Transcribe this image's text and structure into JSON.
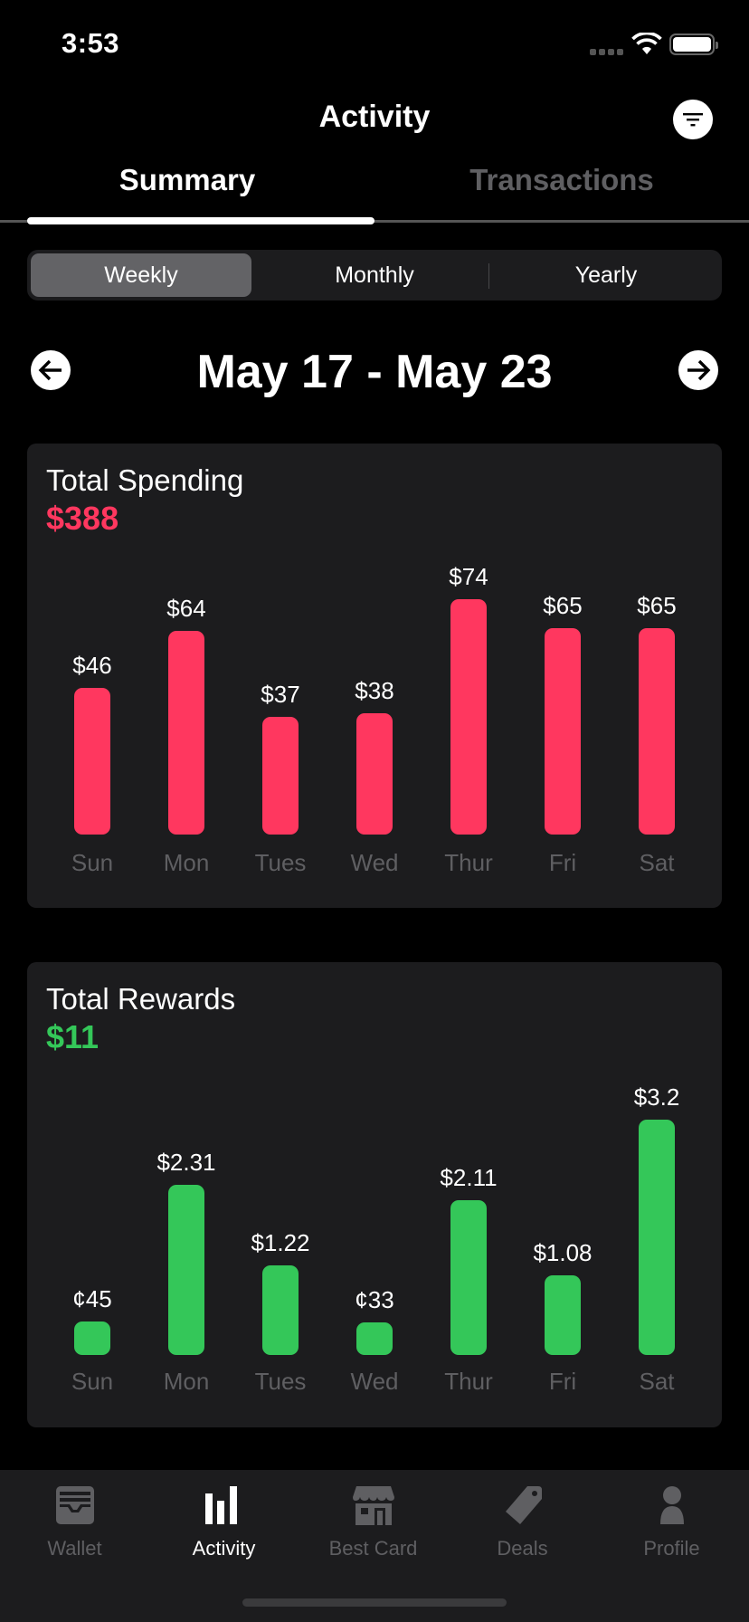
{
  "status_bar": {
    "time": "3:53"
  },
  "nav": {
    "title": "Activity",
    "filter_icon": "filter-icon"
  },
  "tabs": [
    {
      "label": "Summary",
      "active": true
    },
    {
      "label": "Transactions",
      "active": false
    }
  ],
  "period_selector": {
    "options": [
      "Weekly",
      "Monthly",
      "Yearly"
    ],
    "selected": "Weekly"
  },
  "date_range": {
    "label": "May 17 - May 23",
    "prev_icon": "arrow-left-circle-icon",
    "next_icon": "arrow-right-circle-icon"
  },
  "colors": {
    "spending": "#ff375f",
    "rewards": "#34c759",
    "card_bg": "#1c1c1e",
    "inactive": "#5f5f62"
  },
  "spending": {
    "title": "Total Spending",
    "total": "$388"
  },
  "rewards": {
    "title": "Total Rewards",
    "total": "$11"
  },
  "chart_data": [
    {
      "type": "bar",
      "title": "Total Spending",
      "categories": [
        "Sun",
        "Mon",
        "Tues",
        "Wed",
        "Thur",
        "Fri",
        "Sat"
      ],
      "values": [
        46,
        64,
        37,
        38,
        74,
        65,
        65
      ],
      "value_labels": [
        "$46",
        "$64",
        "$37",
        "$38",
        "$74",
        "$65",
        "$65"
      ],
      "xlabel": "",
      "ylabel": "",
      "ylim": [
        0,
        74
      ],
      "grid": false
    },
    {
      "type": "bar",
      "title": "Total Rewards",
      "categories": [
        "Sun",
        "Mon",
        "Tues",
        "Wed",
        "Thur",
        "Fri",
        "Sat"
      ],
      "values": [
        0.45,
        2.31,
        1.22,
        0.33,
        2.11,
        1.08,
        3.2
      ],
      "value_labels": [
        "¢45",
        "$2.31",
        "$1.22",
        "¢33",
        "$2.11",
        "$1.08",
        "$3.2"
      ],
      "xlabel": "",
      "ylabel": "",
      "ylim": [
        0,
        3.2
      ],
      "grid": false
    }
  ],
  "tab_bar": {
    "items": [
      {
        "label": "Wallet",
        "icon": "wallet-icon",
        "active": false
      },
      {
        "label": "Activity",
        "icon": "bar-chart-icon",
        "active": true
      },
      {
        "label": "Best Card",
        "icon": "storefront-icon",
        "active": false
      },
      {
        "label": "Deals",
        "icon": "tag-icon",
        "active": false
      },
      {
        "label": "Profile",
        "icon": "person-icon",
        "active": false
      }
    ]
  }
}
